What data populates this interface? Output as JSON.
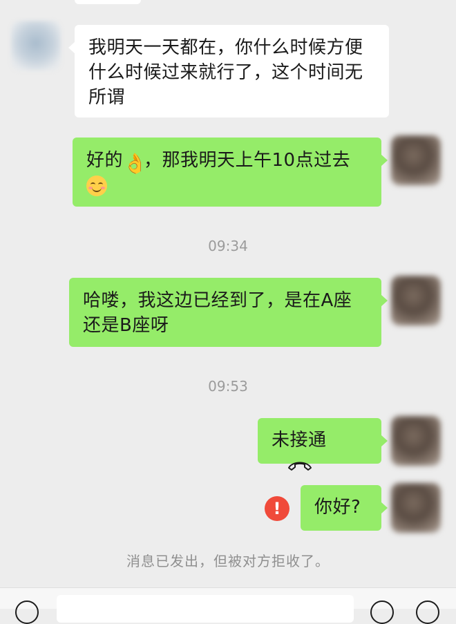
{
  "messages": [
    {
      "side": "left",
      "text": "我明天一天都在，你什么时候方便什么时候过来就行了，这个时间无所谓"
    },
    {
      "side": "right",
      "text": "好的👌，那我明天上午10点过去😊",
      "text_before": "好的",
      "text_middle": "，那我明天上午10点过去"
    },
    {
      "side": "right",
      "text": "哈喽，我这边已经到了，是在A座还是B座呀"
    },
    {
      "side": "right",
      "type": "call",
      "text": "未接通",
      "icon": "phone-hangup-icon"
    },
    {
      "side": "right",
      "text": "你好?",
      "status": "rejected",
      "status_icon": "error-icon"
    }
  ],
  "timestamps": [
    "09:34",
    "09:53"
  ],
  "error_glyph": "!",
  "system_notice": "消息已发出，但被对方拒收了。",
  "colors": {
    "background": "#ededed",
    "sent_bubble": "#95ec69",
    "received_bubble": "#ffffff",
    "error": "#f04a3a"
  }
}
